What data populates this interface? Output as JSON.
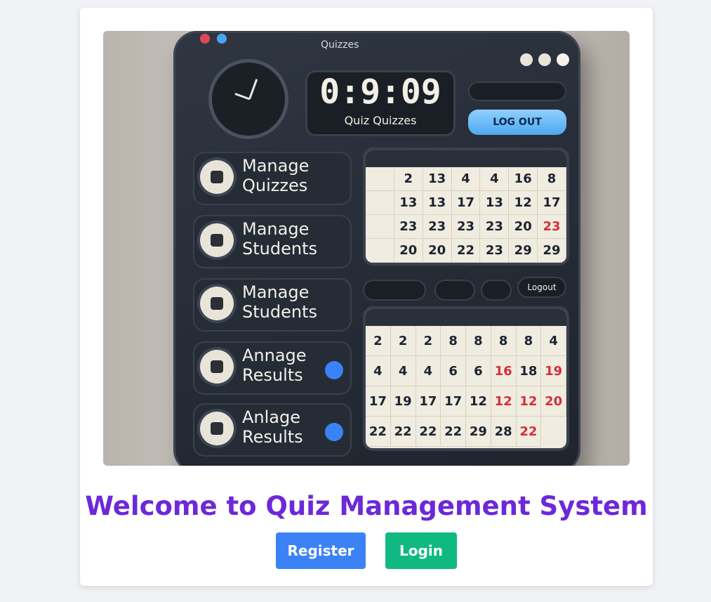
{
  "hero_image": {
    "window_title": "Quizzes",
    "timer": "0:9:09",
    "timer_caption": "Quiz Quizzes",
    "logout_top": "LOG OUT",
    "logout_mid": "Logout",
    "menu": [
      {
        "line1": "Manage",
        "line2": "Quizzes"
      },
      {
        "line1": "Manage",
        "line2": "Students"
      },
      {
        "line1": "Manage",
        "line2": "Students"
      },
      {
        "line1": "Annage",
        "line2": "Results"
      },
      {
        "line1": "Anlage",
        "line2": "Results"
      }
    ],
    "calendar_top_rows": [
      [
        "",
        "2",
        "13",
        "4",
        "4",
        "16",
        "8"
      ],
      [
        "",
        "13",
        "13",
        "17",
        "13",
        "12",
        "17"
      ],
      [
        "",
        "23",
        "23",
        "23",
        "23",
        "20",
        "23"
      ],
      [
        "",
        "20",
        "20",
        "22",
        "23",
        "29",
        "29"
      ]
    ],
    "calendar_bottom_rows": [
      [
        "2",
        "2",
        "2",
        "8",
        "8",
        "8",
        "8"
      ],
      [
        "4",
        "4",
        "4",
        "4",
        "6",
        "6",
        "16",
        "18"
      ],
      [
        "19",
        "17",
        "19",
        "17",
        "17",
        "12",
        "12",
        "12"
      ],
      [
        "20",
        "22",
        "22",
        "22",
        "22",
        "29",
        "28",
        "22"
      ]
    ],
    "colors": {
      "device": "#2a3039",
      "accent_blue": "#4fa9f0",
      "paper": "#f0ece0",
      "red_digit": "#d32f3c"
    }
  },
  "page": {
    "title": "Welcome to Quiz Management System",
    "register_label": "Register",
    "login_label": "Login"
  },
  "colors": {
    "title": "#6d28d9",
    "register": "#3b82f6",
    "login": "#10b981",
    "background": "#f0f2f5"
  }
}
